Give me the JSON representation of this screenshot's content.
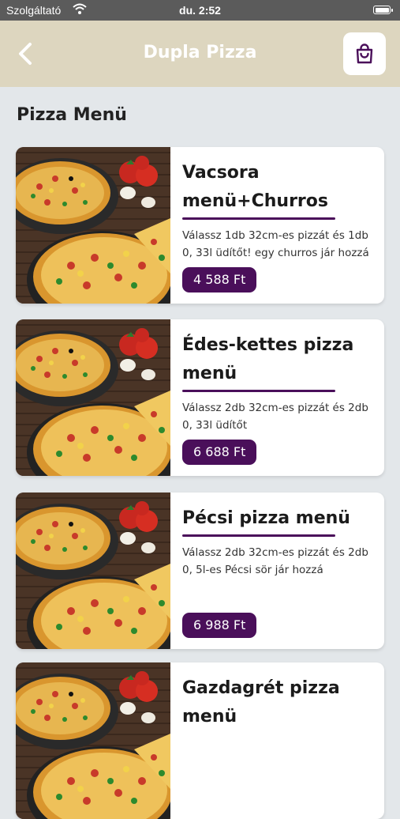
{
  "status_bar": {
    "carrier": "Szolgáltató",
    "time": "du. 2:52"
  },
  "nav": {
    "title": "Dupla Pizza",
    "back_icon": "chevron-left-icon",
    "cart_icon": "shopping-bag-icon"
  },
  "section": {
    "title": "Pizza Menü"
  },
  "colors": {
    "accent": "#4a0f5a",
    "header_bg": "#ddd6bf",
    "page_bg": "#e3e7ea"
  },
  "items": [
    {
      "name": "Vacsora menü+Churros",
      "description": "Válassz 1db 32cm-es pizzát és 1db 0, 33l üdítőt! egy churros jár hozzá",
      "price": "4 588 Ft"
    },
    {
      "name": "Édes-kettes pizza menü",
      "description": "Válassz 2db 32cm-es pizzát és 2db 0, 33l üdítőt",
      "price": "6 688 Ft"
    },
    {
      "name": "Pécsi pizza menü",
      "description": "Válassz 2db 32cm-es pizzát és 2db 0, 5l-es Pécsi sör jár hozzá",
      "price": "6 988 Ft"
    },
    {
      "name": "Gazdagrét pizza menü",
      "description": "",
      "price": ""
    }
  ]
}
